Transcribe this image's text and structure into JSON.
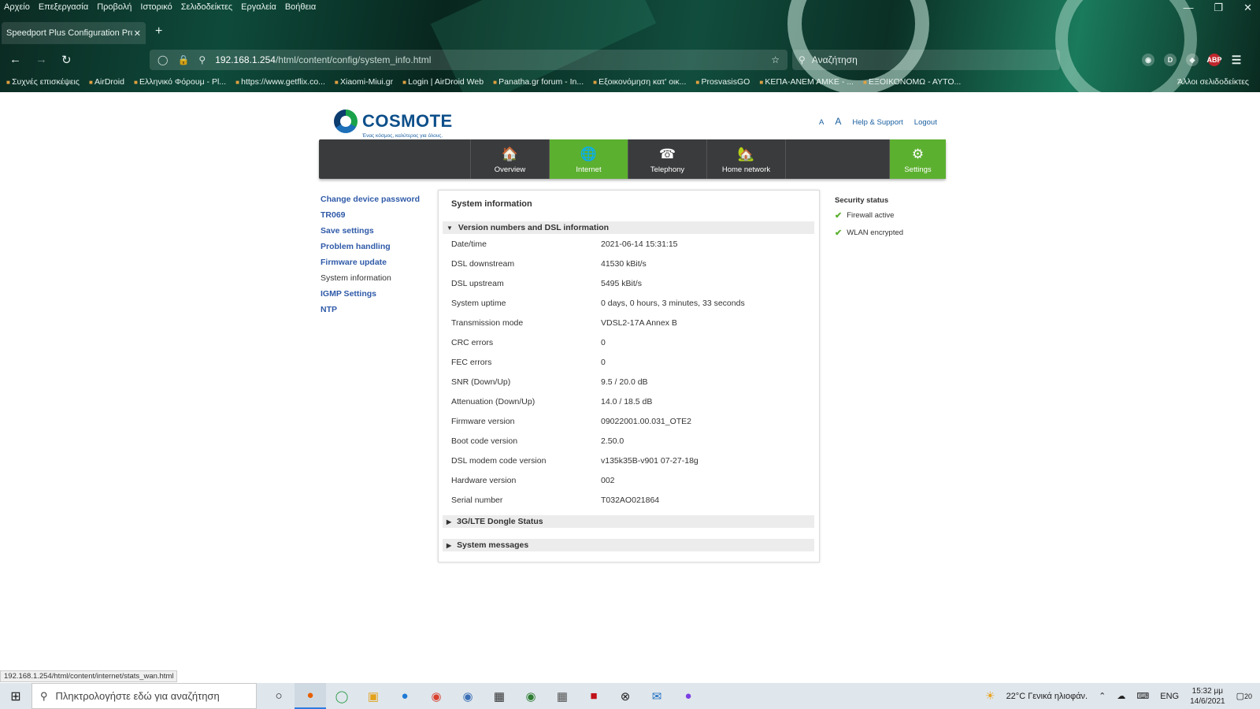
{
  "browser": {
    "menu": [
      "Αρχείο",
      "Επεξεργασία",
      "Προβολή",
      "Ιστορικό",
      "Σελιδοδείκτες",
      "Εργαλεία",
      "Βοήθεια"
    ],
    "tab_title": "Speedport Plus Configuration Prog",
    "url_host": "192.168.1.254",
    "url_path": "/html/content/config/system_info.html",
    "search_placeholder": "Αναζήτηση",
    "bookmarks": [
      "Συχνές επισκέψεις",
      "AirDroid",
      "Ελληνικό Φόρουμ - Pl...",
      "https://www.getflix.co...",
      "Xiaomi-Miui.gr",
      "Login | AirDroid Web",
      "Panatha.gr forum - In...",
      "Εξοικονόμηση κατ' οικ...",
      "ProsvasisGO",
      "ΚΕΠΑ-ΑΝΕΜ ΑΜΚΕ - ...",
      "ΕΞΟΙΚΟΝΟΜΩ - ΑΥΤΟ..."
    ],
    "other_bookmarks": "Άλλοι σελιδοδείκτες",
    "status_url": "192.168.1.254/html/content/internet/stats_wan.html"
  },
  "header": {
    "brand": "COSMOTE",
    "slogan": "Ένας κόσμος, καλύτερος για όλους.",
    "font_small": "A",
    "font_large": "A",
    "help": "Help & Support",
    "logout": "Logout"
  },
  "nav": {
    "overview": "Overview",
    "internet": "Internet",
    "telephony": "Telephony",
    "home_network": "Home network",
    "settings": "Settings"
  },
  "sidebar": [
    "Change device password",
    "TR069",
    "Save settings",
    "Problem handling",
    "Firmware update",
    "System information",
    "IGMP Settings",
    "NTP"
  ],
  "panel": {
    "title": "System information",
    "section_version": "Version numbers and DSL information",
    "section_dongle": "3G/LTE Dongle Status",
    "section_messages": "System messages",
    "rows": [
      {
        "label": "Date/time",
        "value": "2021-06-14 15:31:15"
      },
      {
        "label": "DSL downstream",
        "value": "41530 kBit/s"
      },
      {
        "label": "DSL upstream",
        "value": "5495 kBit/s"
      },
      {
        "label": "System uptime",
        "value": "0 days, 0 hours, 3 minutes, 33 seconds"
      },
      {
        "label": "Transmission mode",
        "value": "VDSL2-17A Annex B"
      },
      {
        "label": "CRC errors",
        "value": "0"
      },
      {
        "label": "FEC errors",
        "value": "0"
      },
      {
        "label": "SNR (Down/Up)",
        "value": "9.5 / 20.0 dB"
      },
      {
        "label": "Attenuation (Down/Up)",
        "value": "14.0 / 18.5 dB"
      },
      {
        "label": "Firmware version",
        "value": "09022001.00.031_OTE2"
      },
      {
        "label": "Boot code version",
        "value": "2.50.0"
      },
      {
        "label": "DSL modem code version",
        "value": "v135k35B-v901 07-27-18g"
      },
      {
        "label": "Hardware version",
        "value": "002"
      },
      {
        "label": "Serial number",
        "value": "T032AO021864"
      }
    ]
  },
  "security": {
    "title": "Security status",
    "firewall": "Firewall active",
    "wlan": "WLAN encrypted"
  },
  "taskbar": {
    "search_placeholder": "Πληκτρολογήστε εδώ για αναζήτηση",
    "weather": "22°C  Γενικά ηλιοφάν.",
    "lang": "ENG",
    "time": "15:32 μμ",
    "date": "14/6/2021",
    "notif_count": "20"
  }
}
